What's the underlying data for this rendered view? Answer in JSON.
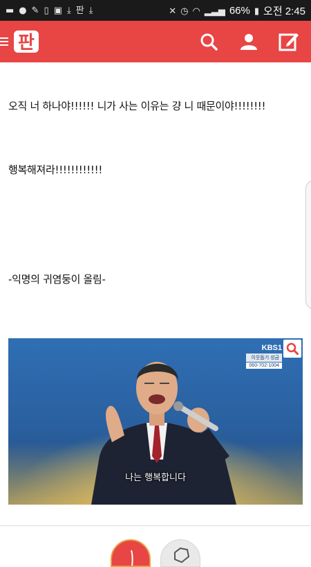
{
  "status_bar": {
    "battery": "66%",
    "time": "오전 2:45"
  },
  "app_bar": {
    "logo_text": "판",
    "menu_icon": "hamburger-icon",
    "actions": [
      {
        "icon": "search-icon"
      },
      {
        "icon": "user-icon"
      },
      {
        "icon": "compose-icon"
      }
    ],
    "color": "#e84545"
  },
  "post": {
    "line1": "오직 너 하나야!!!!!! 니가 사는 이유는 걍 니 때문이야!!!!!!!!",
    "line2": "행복해져라!!!!!!!!!!!!",
    "line3": "-익명의 귀염둥이 올림-",
    "image": {
      "broadcaster": "KBS1",
      "caption_small": "이웃돕기 성금",
      "phone": "060-702-1004",
      "subtitle": "나는 행복합니다"
    }
  },
  "reactions": {
    "up_icon": "like-icon",
    "down_icon": "dislike-icon"
  }
}
